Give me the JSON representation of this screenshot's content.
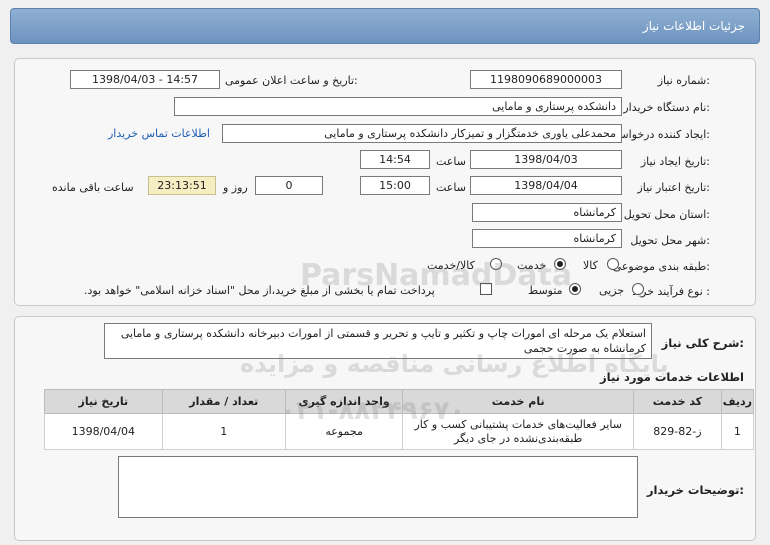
{
  "header": {
    "title": "جزئیات اطلاعات نیاز"
  },
  "form": {
    "need_number_label": "شماره نیاز:",
    "need_number": "1198090689000003",
    "announce_label": "تاریخ و ساعت اعلان عمومی:",
    "announce_value": "1398/04/03 - 14:57",
    "buyer_org_label": "نام دستگاه خریدار:",
    "buyer_org": "دانشکده پرستاری و مامایی",
    "requester_label": "ایجاد کننده درخواست:",
    "requester": "محمدعلی یاوری خدمتگزار و تمیزکار دانشکده پرستاری و مامایی",
    "contact_link": "اطلاعات تماس خریدار",
    "created_label": "تاریخ ایجاد نیاز:",
    "created_date": "1398/04/03",
    "time_label": "ساعت",
    "created_time": "14:54",
    "validity_label": "تاریخ اعتبار نیاز:",
    "validity_date": "1398/04/04",
    "validity_time": "15:00",
    "days_value": "0",
    "days_label": "روز و",
    "remaining_value": "23:13:51",
    "remaining_label": "ساعت باقی مانده",
    "province_label": "استان محل تحویل:",
    "province": "کرمانشاه",
    "city_label": "شهر محل تحویل:",
    "city": "کرمانشاه",
    "category_label": "طبقه بندی موضوعی:",
    "category_options": [
      "کالا",
      "خدمت",
      "کالا/خدمت"
    ],
    "category_selected": "خدمت",
    "process_label": "نوع فرآیند خرید :",
    "process_options": [
      "جزیی",
      "متوسط"
    ],
    "process_selected": "متوسط",
    "payment_note": "پرداخت تمام یا بخشی از مبلغ خرید،از محل \"اسناد خزانه اسلامی\" خواهد بود."
  },
  "description": {
    "label": "شرح کلی نیاز:",
    "text": "استعلام یک مرحله ای امورات چاپ و تکثیر و تایپ و تحریر و قسمتی  از امورات دبیرخانه دانشکده پرستاری و مامایی کرمانشاه به صورت حجمی"
  },
  "services": {
    "section_title": "اطلاعات خدمات مورد نیاز",
    "columns": [
      "ردیف",
      "کد خدمت",
      "نام خدمت",
      "واحد اندازه گیری",
      "تعداد / مقدار",
      "تاریخ نیاز"
    ],
    "rows": [
      {
        "index": "1",
        "code": "ز-82-829",
        "name": "سایر فعالیت‌های خدمات پشتیبانی کسب و کار طبقه‌بندی‌نشده در جای دیگر",
        "unit": "مجموعه",
        "qty": "1",
        "date": "1398/04/04"
      }
    ]
  },
  "buyer_notes": {
    "label": "توضیحات خریدار:",
    "text": ""
  },
  "watermark": {
    "line1": "پایگاه اطلاع رسانی مناقصه و مزایده",
    "line2": "ParsNamadData",
    "line3": "۰۲۱-۸۸۳۴۹۶۷۰"
  }
}
